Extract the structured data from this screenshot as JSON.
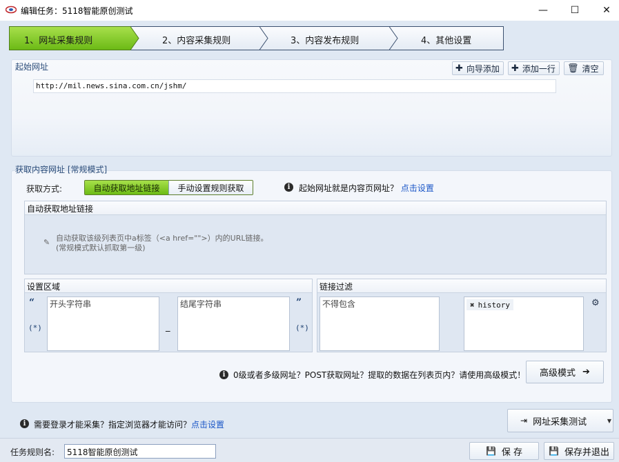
{
  "window": {
    "title": "编辑任务：5118智能原创测试",
    "minimize_glyph": "—",
    "maximize_glyph": "☐",
    "close_glyph": "✕"
  },
  "steps": [
    {
      "label": "1、网址采集规则",
      "active": true
    },
    {
      "label": "2、内容采集规则",
      "active": false
    },
    {
      "label": "3、内容发布规则",
      "active": false
    },
    {
      "label": "4、其他设置",
      "active": false
    }
  ],
  "start_url": {
    "section_title": "起始网址",
    "buttons": {
      "wizard_add": "向导添加",
      "add_row": "添加一行",
      "clear": "清空"
    },
    "url_value": "http://mil.news.sina.com.cn/jshm/"
  },
  "fetch": {
    "section_title": "获取内容网址 [常规模式]",
    "method_label": "获取方式:",
    "modes": {
      "auto": "自动获取地址链接",
      "manual": "手动设置规则获取"
    },
    "start_is_content_hint": "起始网址就是内容页网址？",
    "start_is_content_link": "点击设置",
    "auto_box_title": "自动获取地址链接",
    "auto_desc_line1": "自动获取该级列表页中a标签（<a href=\"\">）内的URL链接。",
    "auto_desc_line2": "(常规模式默认抓取第一级)",
    "area_title": "设置区域",
    "start_string_placeholder": "开头字符串",
    "end_string_placeholder": "结尾字符串",
    "open_quote": "“",
    "close_quote": "”",
    "wildcard": "(*)",
    "separator": "_",
    "filter_title": "链接过滤",
    "must_not_contain": "不得包含",
    "filter_tags": [
      "history"
    ],
    "advanced_hint": "0级或者多级网址？POST获取网址？提取的数据在列表页内？请使用高级模式！",
    "advanced_button": "高级模式"
  },
  "login": {
    "hint": "需要登录才能采集？指定浏览器才能访问？",
    "link": "点击设置",
    "test_button": "网址采集测试"
  },
  "footer": {
    "rule_name_label": "任务规则名:",
    "rule_name_value": "5118智能原创测试",
    "save_button": "保 存",
    "save_exit_button": "保存并退出"
  },
  "colors": {
    "active_step": "#7cc81f",
    "panel_bg": "#dfe8f3",
    "link": "#1a56c7"
  }
}
